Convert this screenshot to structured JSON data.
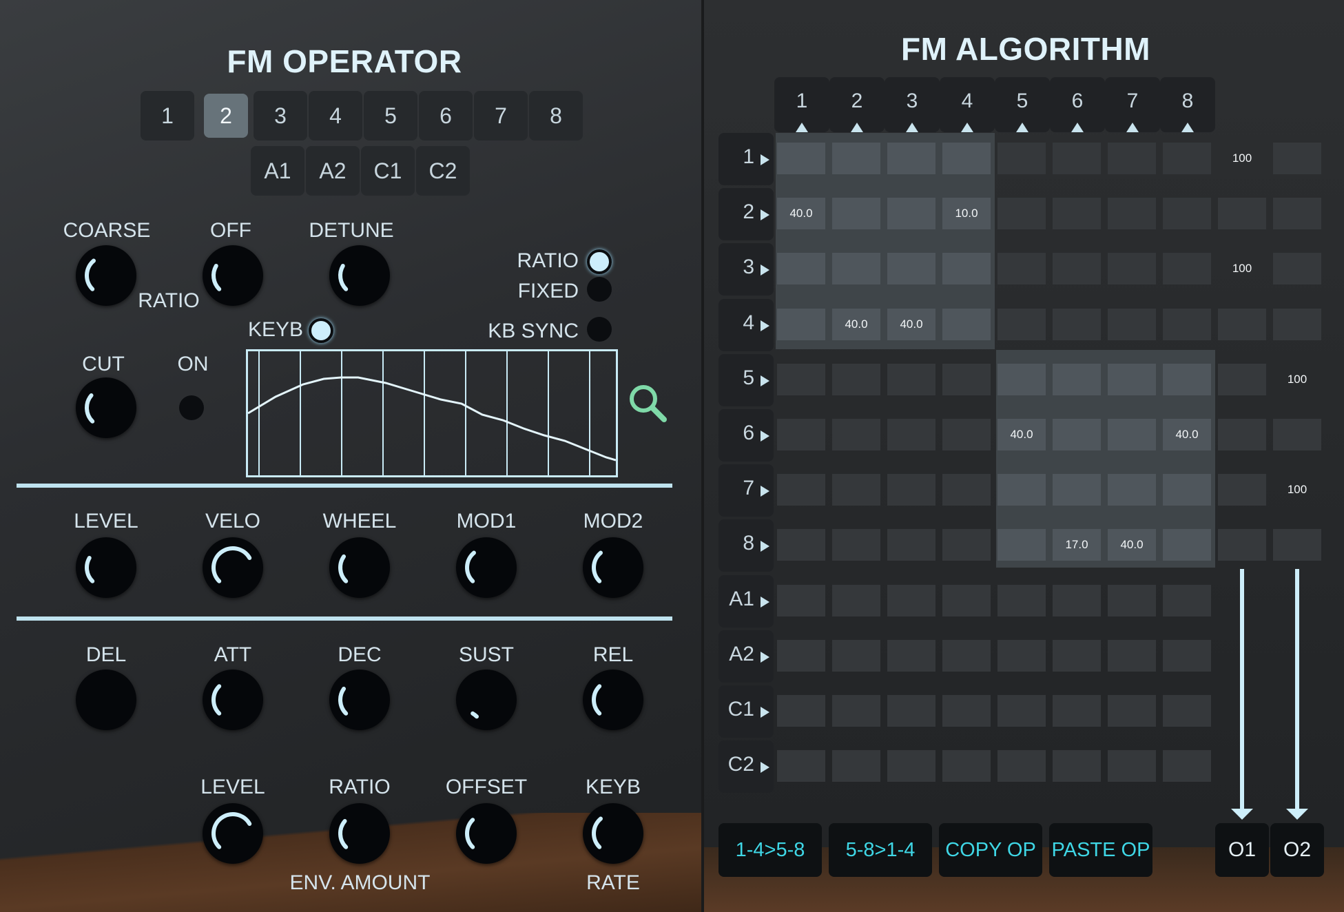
{
  "operator": {
    "title": "FM OPERATOR",
    "ops": [
      "1",
      "2",
      "3",
      "4",
      "5",
      "6",
      "7",
      "8"
    ],
    "selected": "2",
    "sub_ops": [
      "A1",
      "A2",
      "C1",
      "C2"
    ],
    "knob_labels": {
      "coarse": "COARSE",
      "off": "OFF",
      "detune": "DETUNE",
      "ratio": "RATIO",
      "cut": "CUT",
      "on": "ON"
    },
    "mode": {
      "ratio": "RATIO",
      "fixed": "FIXED",
      "ratio_on": true,
      "fixed_on": false
    },
    "keyb": {
      "label": "KEYB",
      "on": true
    },
    "kbsync": {
      "label": "KB SYNC",
      "on": false
    },
    "mod_labels": [
      "LEVEL",
      "VELO",
      "WHEEL",
      "MOD1",
      "MOD2"
    ],
    "env_labels": [
      "DEL",
      "ATT",
      "DEC",
      "SUST",
      "REL"
    ],
    "amount_labels": [
      "LEVEL",
      "RATIO",
      "OFFSET",
      "KEYB"
    ],
    "env_amount": "ENV. AMOUNT",
    "rate": "RATE"
  },
  "algorithm": {
    "title": "FM ALGORITHM",
    "cols": [
      "1",
      "2",
      "3",
      "4",
      "5",
      "6",
      "7",
      "8"
    ],
    "rows": [
      "1",
      "2",
      "3",
      "4",
      "5",
      "6",
      "7",
      "8",
      "A1",
      "A2",
      "C1",
      "C2"
    ],
    "cells": {
      "2-1": "40.0",
      "2-4": "10.0",
      "4-2": "40.0",
      "4-3": "40.0",
      "6-5": "40.0",
      "6-8": "40.0",
      "8-6": "17.0",
      "8-7": "40.0"
    },
    "out1": {
      "1": "100",
      "3": "100"
    },
    "out2": {
      "5": "100",
      "7": "100"
    },
    "buttons": [
      "1-4>5-8",
      "5-8>1-4",
      "COPY OP",
      "PASTE OP"
    ],
    "outs": [
      "O1",
      "O2"
    ]
  },
  "colors": {
    "accent": "#3fd7e6",
    "led": "#cdeefc",
    "line": "#bfe3ef"
  }
}
